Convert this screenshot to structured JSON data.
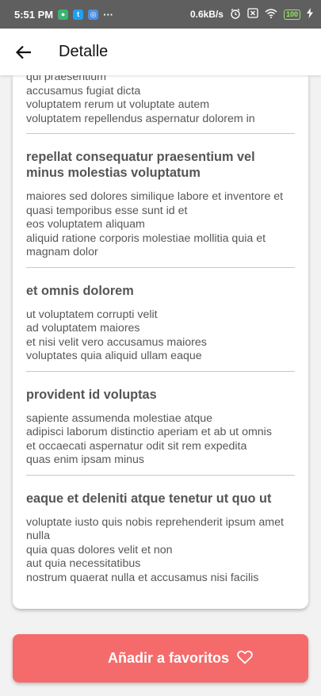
{
  "status_bar": {
    "time": "5:51 PM",
    "more": "···",
    "net_speed": "0.6kB/s",
    "battery": "100"
  },
  "app_bar": {
    "title": "Detalle"
  },
  "content": {
    "top_body": "qui praesentium\naccusamus fugiat dicta\nvoluptatem rerum ut voluptate autem\nvoluptatem repellendus aspernatur dolorem in",
    "posts": [
      {
        "title": "repellat consequatur praesentium vel minus molestias voluptatum",
        "body": "maiores sed dolores similique labore et inventore et\nquasi temporibus esse sunt id et\neos voluptatem aliquam\naliquid ratione corporis molestiae mollitia quia et magnam dolor"
      },
      {
        "title": "et omnis dolorem",
        "body": "ut voluptatem corrupti velit\nad voluptatem maiores\net nisi velit vero accusamus maiores\nvoluptates quia aliquid ullam eaque"
      },
      {
        "title": "provident id voluptas",
        "body": "sapiente assumenda molestiae atque\nadipisci laborum distinctio aperiam et ab ut omnis\net occaecati aspernatur odit sit rem expedita\nquas enim ipsam minus"
      },
      {
        "title": "eaque et deleniti atque tenetur ut quo ut",
        "body": "voluptate iusto quis nobis reprehenderit ipsum amet nulla\nquia quas dolores velit et non\naut quia necessitatibus\nnostrum quaerat nulla et accusamus nisi facilis"
      }
    ]
  },
  "favorite_button": {
    "label": "Añadir a favoritos"
  },
  "colors": {
    "status_bar": "#5f5f5f",
    "accent": "#f56b6b",
    "text": "#575757"
  },
  "icons": [
    "back-arrow-icon",
    "heart-outline-icon",
    "alarm-icon",
    "close-box-icon",
    "wifi-icon",
    "battery-icon",
    "charging-icon"
  ]
}
